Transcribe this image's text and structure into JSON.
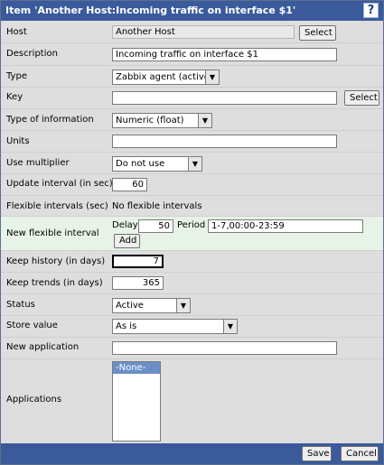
{
  "window": {
    "title": "Item 'Another Host:Incoming traffic on interface $1'",
    "help_label": "?"
  },
  "form": {
    "host": {
      "label": "Host",
      "value": "Another Host",
      "button": "Select"
    },
    "description": {
      "label": "Description",
      "value": "Incoming traffic on interface $1"
    },
    "type": {
      "label": "Type",
      "selected": "Zabbix agent (active)"
    },
    "key": {
      "label": "Key",
      "value": "",
      "button": "Select"
    },
    "type_of_information": {
      "label": "Type of information",
      "selected": "Numeric (float)"
    },
    "units": {
      "label": "Units",
      "value": ""
    },
    "use_multiplier": {
      "label": "Use multiplier",
      "selected": "Do not use"
    },
    "update_interval": {
      "label": "Update interval (in sec)",
      "value": "60"
    },
    "flexible_intervals": {
      "label": "Flexible intervals (sec)",
      "value": "No flexible intervals"
    },
    "new_flexible_interval": {
      "label": "New flexible interval",
      "delay_label": "Delay",
      "delay_value": "50",
      "period_label": "Period",
      "period_value": "1-7,00:00-23:59",
      "add_button": "Add"
    },
    "keep_history": {
      "label": "Keep history (in days)",
      "value": "7"
    },
    "keep_trends": {
      "label": "Keep trends (in days)",
      "value": "365"
    },
    "status": {
      "label": "Status",
      "selected": "Active"
    },
    "store_value": {
      "label": "Store value",
      "selected": "As is"
    },
    "new_application": {
      "label": "New application",
      "value": ""
    },
    "applications": {
      "label": "Applications",
      "options": [
        "-None-"
      ]
    }
  },
  "footer": {
    "save_label": "Save",
    "cancel_label": "Cancel"
  },
  "colors": {
    "titlebar": "#3a5a9c",
    "row_bg": "#dedede",
    "highlight_row": "#e8f3e8",
    "selection": "#6a8fc8"
  }
}
